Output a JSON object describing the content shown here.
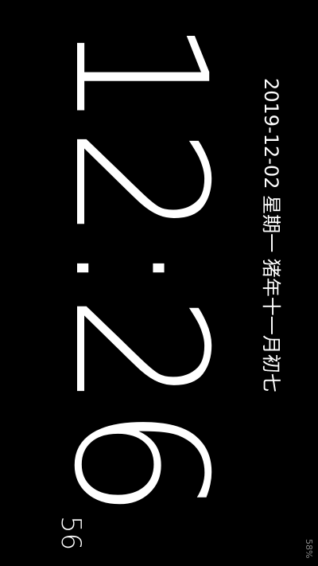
{
  "clock": {
    "time": "12:26",
    "seconds": "56"
  },
  "date_line": {
    "text": "2019-12-02 星期一  猪年十一月初七"
  },
  "status": {
    "battery": "58%"
  },
  "colors": {
    "background": "#000000",
    "foreground": "#ffffff",
    "muted": "#8a8a8a"
  }
}
